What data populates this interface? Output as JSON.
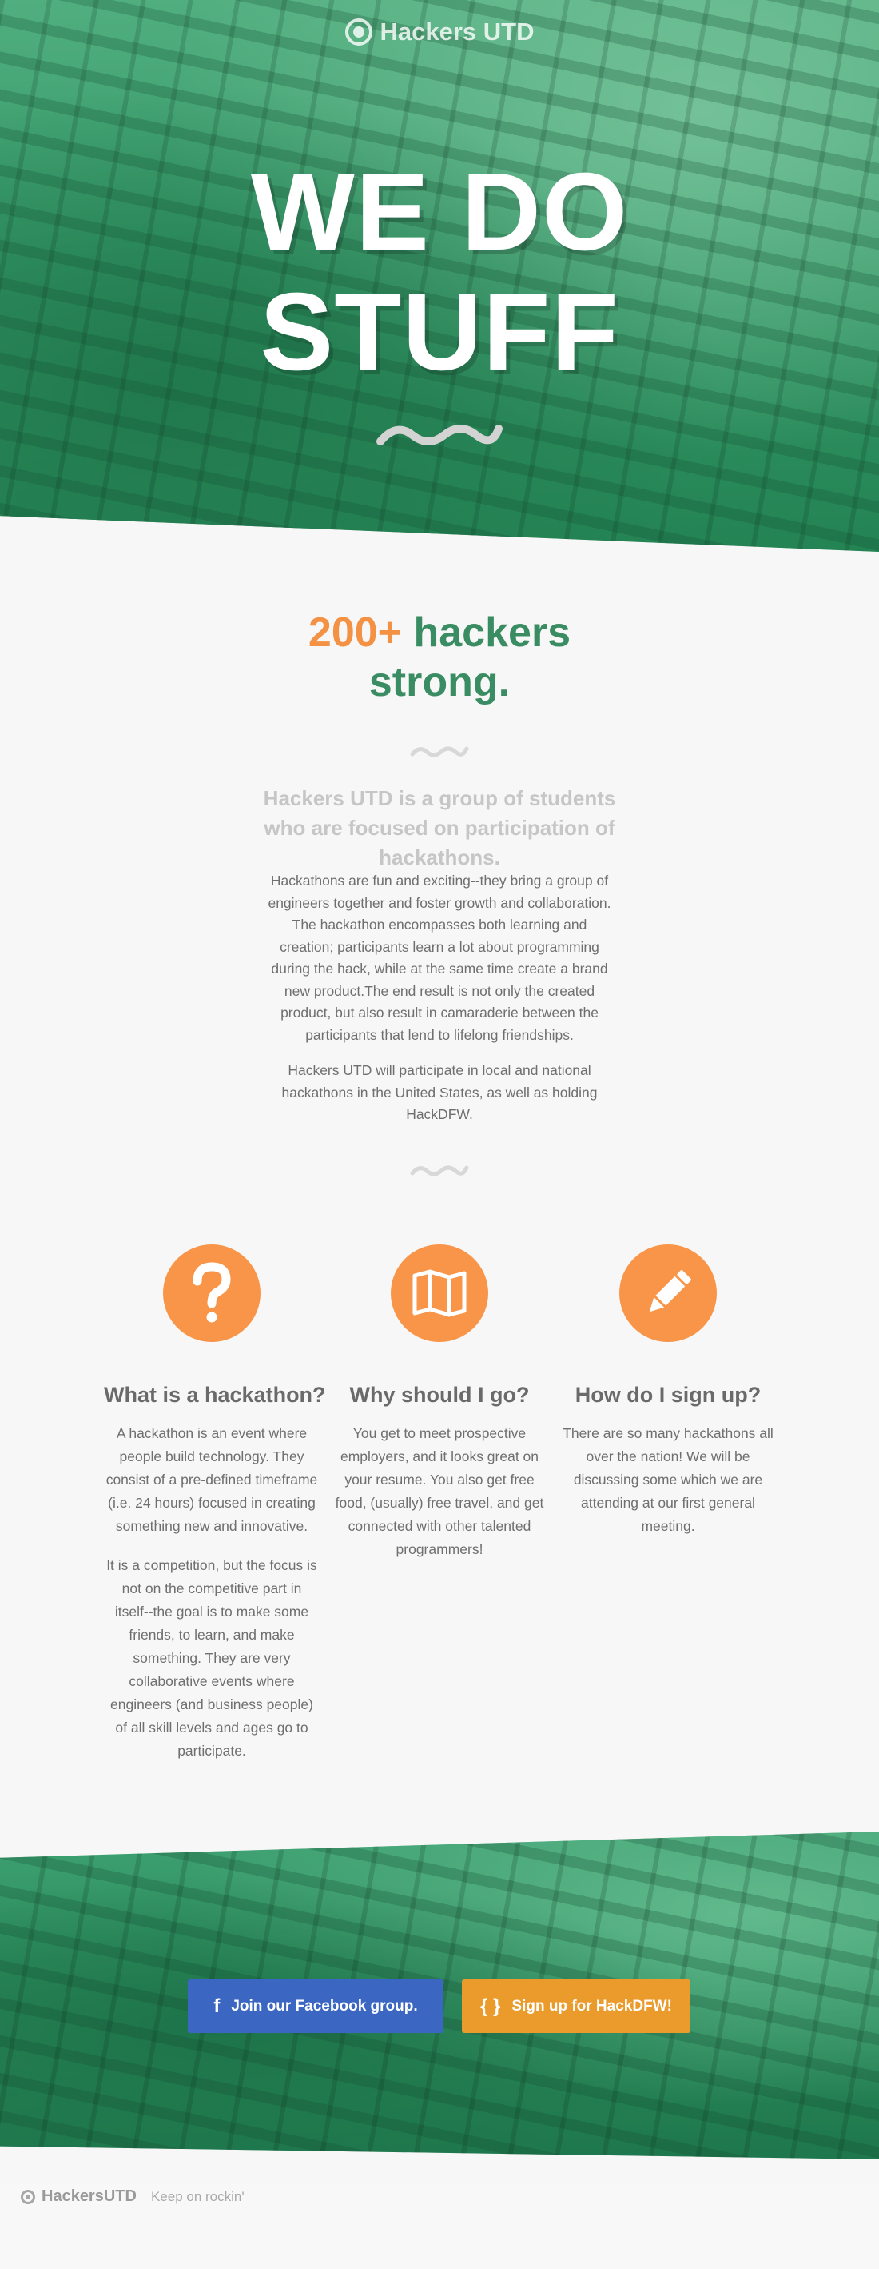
{
  "header": {
    "brand_name": "Hackers UTD",
    "hero_title_line1": "WE DO",
    "hero_title_line2": "STUFF"
  },
  "about": {
    "heading_accent": "200+",
    "heading_rest": " hackers strong.",
    "subheading": "Hackers UTD is a group of students who are focused on participation of hackathons.",
    "paragraph1": "Hackathons are fun and exciting--they bring a group of engineers together and foster growth and collaboration. The hackathon encompasses both learning and creation; participants learn a lot about programming during the hack, while at the same time create a brand new product.The end result is not only the created product, but also result in camaraderie between the participants that lend to lifelong friendships.",
    "paragraph2": "Hackers UTD will participate in local and national hackathons in the United States, as well as holding HackDFW."
  },
  "features": [
    {
      "icon": "question-mark-icon",
      "title": "What is a hackathon?",
      "text1": "A hackathon is an event where people build technology. They consist of a pre-defined timeframe (i.e. 24 hours) focused in creating something new and innovative.",
      "text2": "It is a competition, but the focus is not on the competitive part in itself--the goal is to make some friends, to learn, and make something. They are very collaborative events where engineers (and business people) of all skill levels and ages go to participate."
    },
    {
      "icon": "map-icon",
      "title": "Why should I go?",
      "text1": "You get to meet prospective employers, and it looks great on your resume. You also get free food, (usually) free travel, and get connected with other talented programmers!"
    },
    {
      "icon": "pencil-icon",
      "title": "How do I sign up?",
      "text1": "There are so many hackathons all over the nation! We will be discussing some which we are attending at our first general meeting."
    }
  ],
  "cta": {
    "facebook_icon": "f",
    "facebook_label": "Join our Facebook group.",
    "hackdfw_icon": "{ }",
    "hackdfw_label": "Sign up for HackDFW!"
  },
  "footer": {
    "brand_name": "HackersUTD",
    "tagline": "Keep on rockin'"
  },
  "colors": {
    "accent_orange": "#f39145",
    "brand_green": "#3a8c62",
    "facebook_blue": "#3b67c2",
    "hackdfw_orange": "#eb9b2c"
  }
}
